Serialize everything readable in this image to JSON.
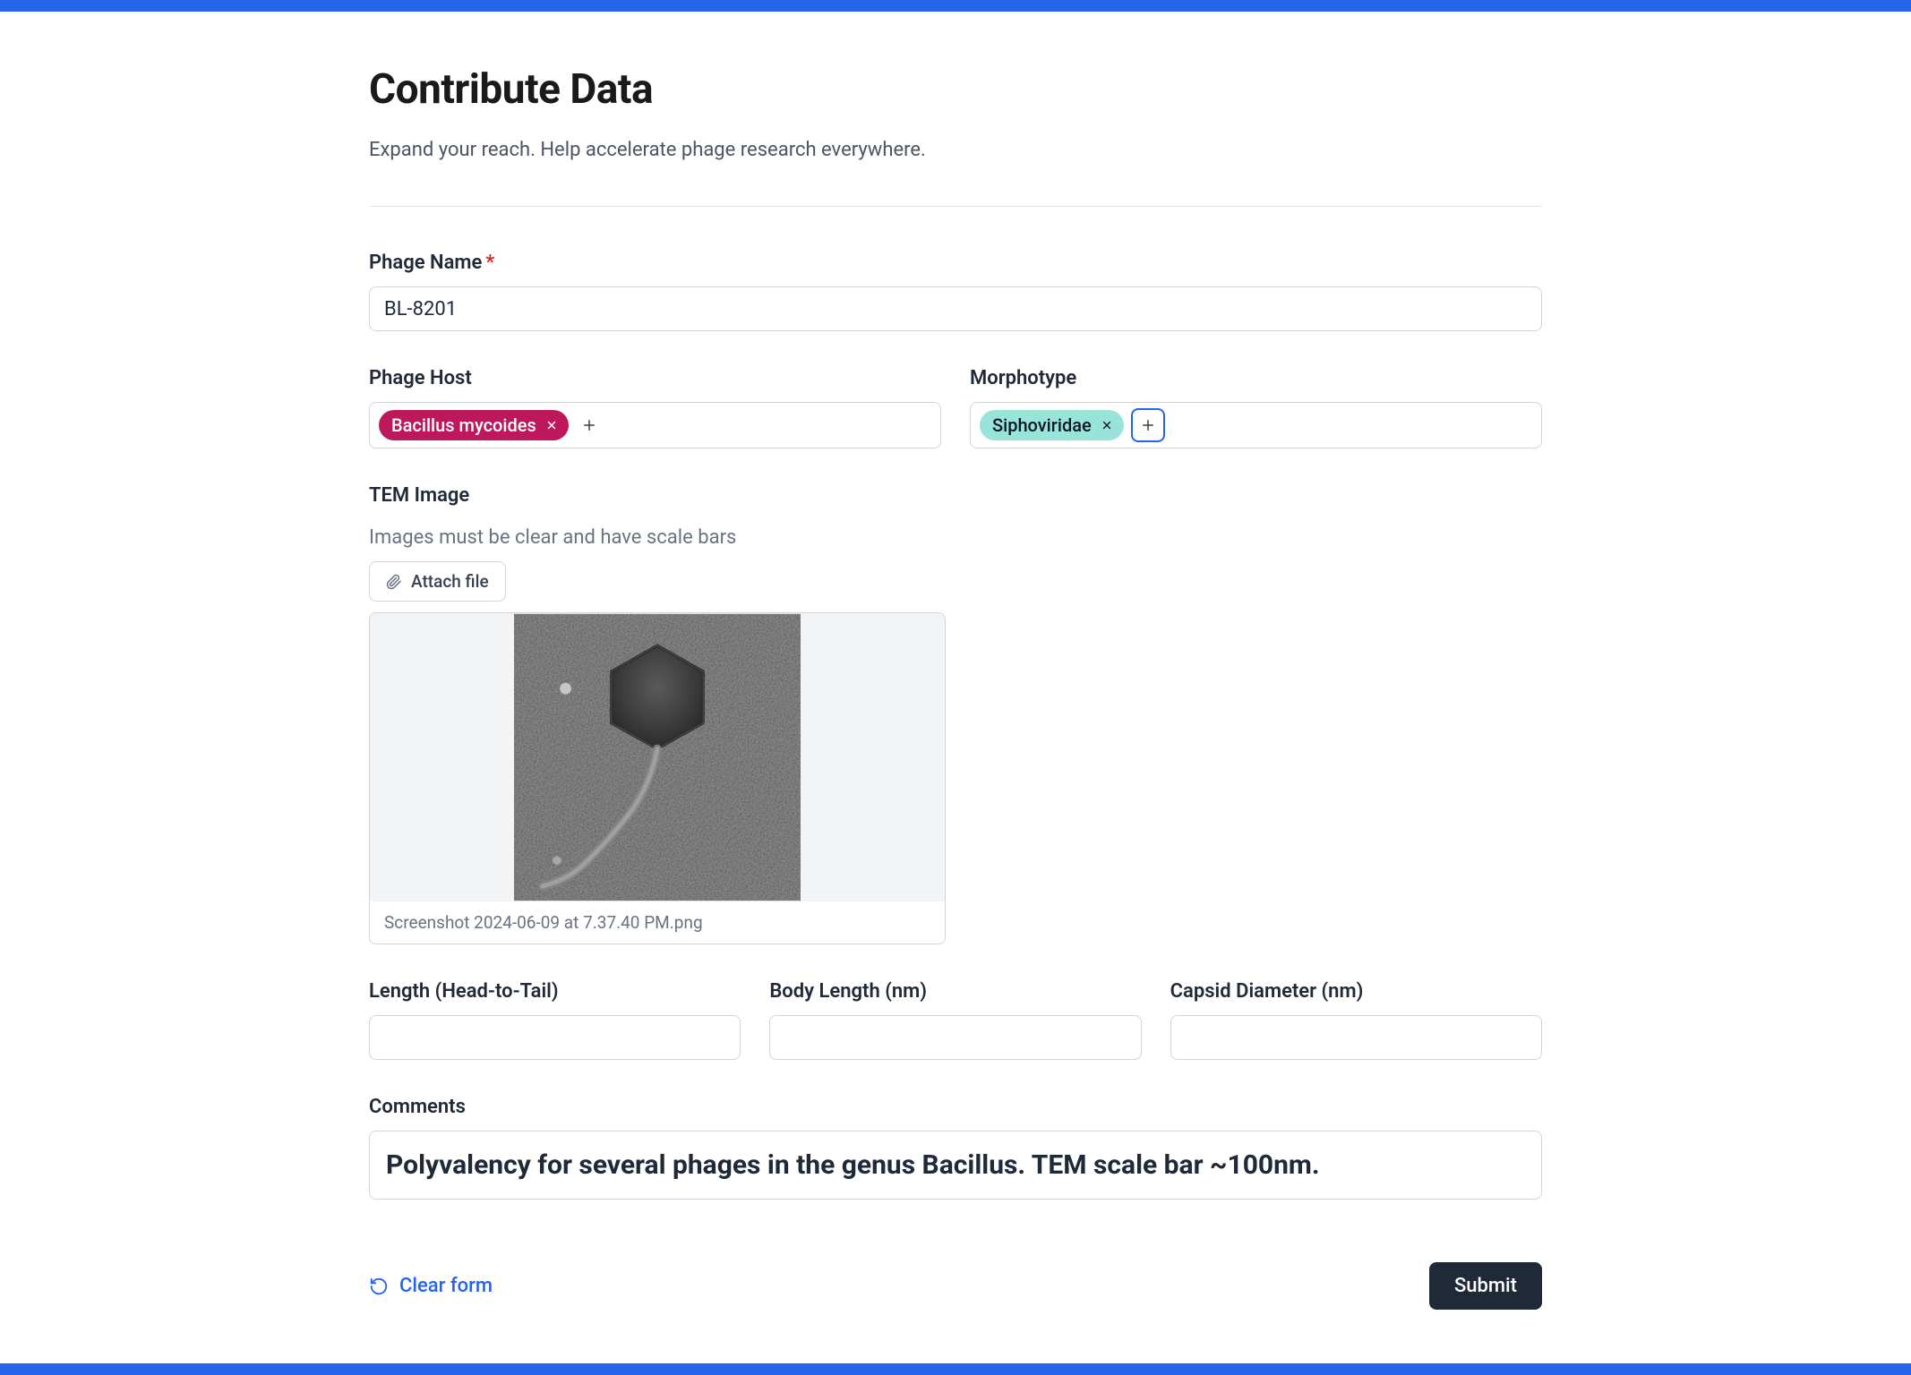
{
  "header": {
    "title": "Contribute Data",
    "subtitle": "Expand your reach. Help accelerate phage research everywhere."
  },
  "form": {
    "phage_name": {
      "label": "Phage Name",
      "required_marker": "*",
      "value": "BL-8201"
    },
    "phage_host": {
      "label": "Phage Host",
      "tags": [
        {
          "text": "Bacillus mycoides"
        }
      ]
    },
    "morphotype": {
      "label": "Morphotype",
      "tags": [
        {
          "text": "Siphoviridae"
        }
      ]
    },
    "tem_image": {
      "label": "TEM Image",
      "helper": "Images must be clear and have scale bars",
      "attach_label": "Attach file",
      "filename": "Screenshot 2024-06-09 at 7.37.40 PM.png"
    },
    "length_head_to_tail": {
      "label": "Length (Head-to-Tail)",
      "value": ""
    },
    "body_length": {
      "label": "Body Length (nm)",
      "value": ""
    },
    "capsid_diameter": {
      "label": "Capsid Diameter (nm)",
      "value": ""
    },
    "comments": {
      "label": "Comments",
      "value": "Polyvalency for several phages in the genus Bacillus. TEM scale bar ~100nm."
    }
  },
  "actions": {
    "clear_label": "Clear form",
    "submit_label": "Submit"
  }
}
